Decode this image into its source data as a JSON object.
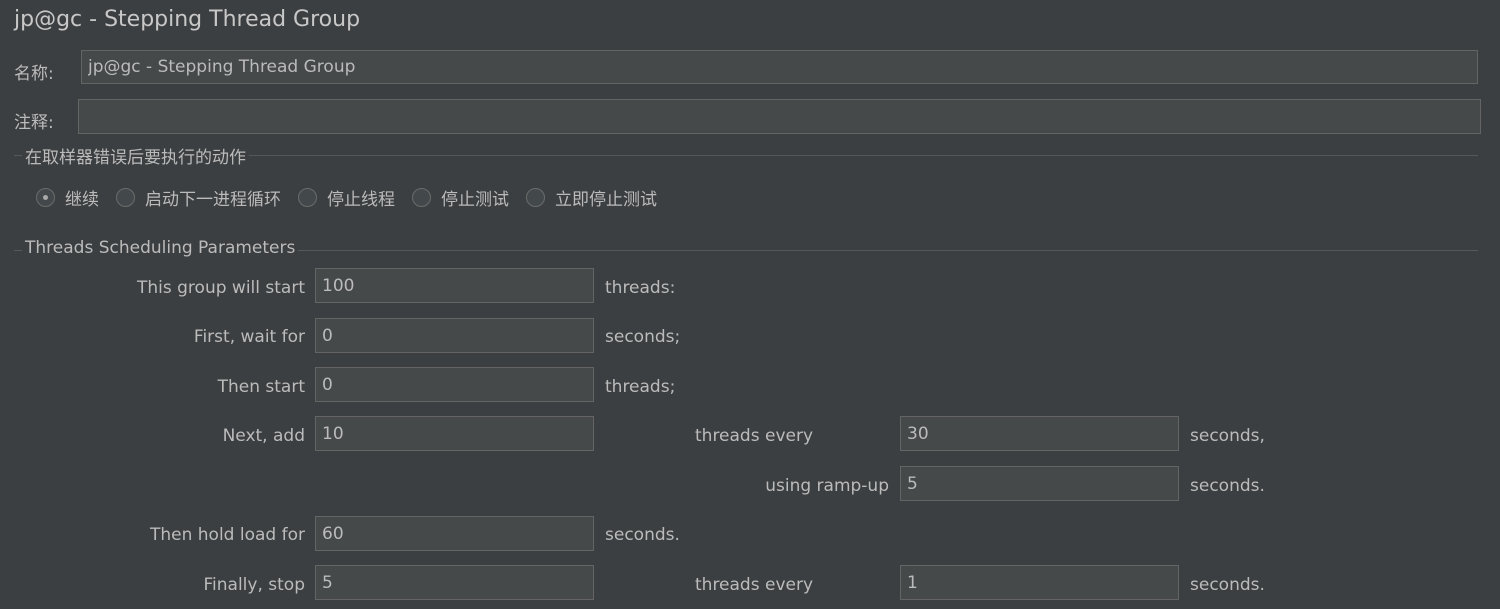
{
  "window": {
    "title": "jp@gc - Stepping Thread Group"
  },
  "name_field": {
    "label": "名称:",
    "value": "jp@gc - Stepping Thread Group"
  },
  "comment_field": {
    "label": "注释:",
    "value": ""
  },
  "sampler_error": {
    "title": "在取样器错误后要执行的动作",
    "options": [
      {
        "label": "继续",
        "selected": true
      },
      {
        "label": "启动下一进程循环",
        "selected": false
      },
      {
        "label": "停止线程",
        "selected": false
      },
      {
        "label": "停止测试",
        "selected": false
      },
      {
        "label": "立即停止测试",
        "selected": false
      }
    ]
  },
  "scheduling": {
    "title": "Threads Scheduling Parameters",
    "start_threads": {
      "label": "This group will start",
      "value": "100",
      "suffix": "threads:"
    },
    "initial_delay": {
      "label": "First, wait for",
      "value": "0",
      "suffix": "seconds;"
    },
    "start_users": {
      "label": "Then start",
      "value": "0",
      "suffix": "threads;"
    },
    "increment": {
      "label": "Next, add",
      "value": "10",
      "middle": "threads every",
      "period": "30",
      "suffix": "seconds,"
    },
    "ramp_up": {
      "label": "using ramp-up",
      "value": "5",
      "suffix": "seconds."
    },
    "hold": {
      "label": "Then hold load for",
      "value": "60",
      "suffix": "seconds."
    },
    "stop": {
      "label": "Finally, stop",
      "value": "5",
      "middle": "threads every",
      "period": "1",
      "suffix": "seconds."
    }
  }
}
